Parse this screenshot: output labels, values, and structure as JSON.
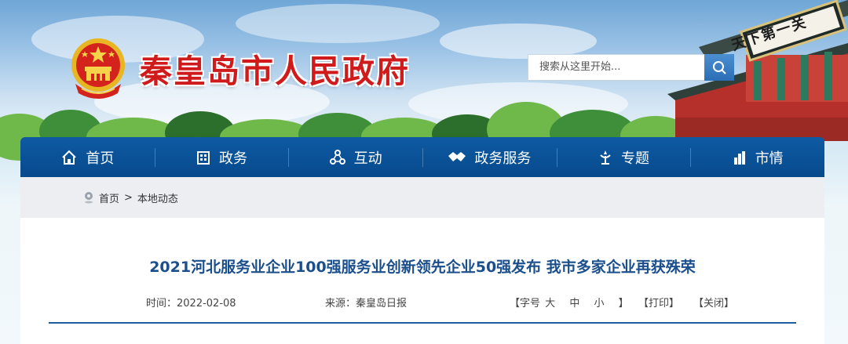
{
  "header": {
    "site_title": "秦皇岛市人民政府",
    "gate_plaque": "天下第一关",
    "search": {
      "placeholder": "搜索从这里开始..."
    }
  },
  "nav": {
    "items": [
      {
        "label": "首页",
        "icon": "home-icon"
      },
      {
        "label": "政务",
        "icon": "building-icon"
      },
      {
        "label": "互动",
        "icon": "interaction-icon"
      },
      {
        "label": "政务服务",
        "icon": "handshake-icon"
      },
      {
        "label": "专题",
        "icon": "topic-icon"
      },
      {
        "label": "市情",
        "icon": "city-icon"
      }
    ]
  },
  "breadcrumb": {
    "home": "首页",
    "separator": ">",
    "current": "本地动态"
  },
  "article": {
    "title": "2021河北服务业企业100强服务业创新领先企业50强发布 我市多家企业再获殊荣",
    "date_label": "时间：",
    "date": "2022-02-08",
    "source_label": "来源：",
    "source": "秦皇岛日报",
    "font_size_prefix": "【字号",
    "font_large": "大",
    "font_medium": "中",
    "font_small": "小",
    "font_size_suffix": "】",
    "print": "【打印】",
    "close": "【关闭】"
  },
  "colors": {
    "nav_bg": "#0e5aa3",
    "title_red": "#cf1b1b",
    "article_title": "#1a4f8c"
  }
}
